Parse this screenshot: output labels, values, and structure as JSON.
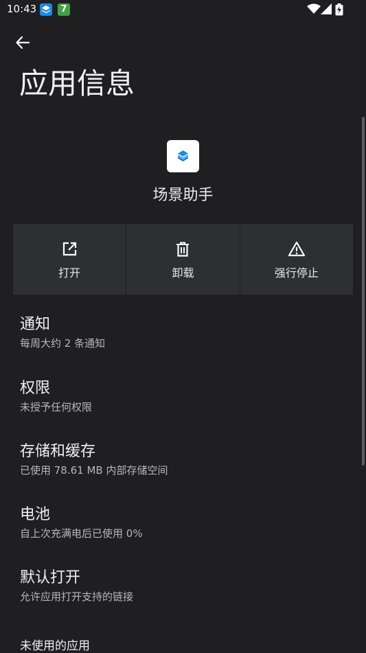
{
  "status_bar": {
    "time": "10:43",
    "icons": [
      "app-notification-icon",
      "seven-badge-icon",
      "wifi-icon",
      "signal-icon",
      "battery-charging-icon"
    ],
    "badge_text": "7"
  },
  "page": {
    "title": "应用信息"
  },
  "app": {
    "name": "场景助手"
  },
  "actions": [
    {
      "label": "打开",
      "icon": "open-external-icon"
    },
    {
      "label": "卸载",
      "icon": "trash-icon"
    },
    {
      "label": "强行停止",
      "icon": "warning-icon"
    }
  ],
  "settings": [
    {
      "title": "通知",
      "subtitle": "每周大约 2 条通知"
    },
    {
      "title": "权限",
      "subtitle": "未授予任何权限"
    },
    {
      "title": "存储和缓存",
      "subtitle": "已使用 78.61 MB 内部存储空间"
    },
    {
      "title": "电池",
      "subtitle": "自上次充满电后已使用 0%"
    },
    {
      "title": "默认打开",
      "subtitle": "允许应用打开支持的链接"
    },
    {
      "title": "未使用的应用"
    }
  ],
  "colors": {
    "background": "#1f1f21",
    "card": "#2e2f33",
    "accent_icon": "#1e88e5",
    "badge_green": "#43a047"
  }
}
